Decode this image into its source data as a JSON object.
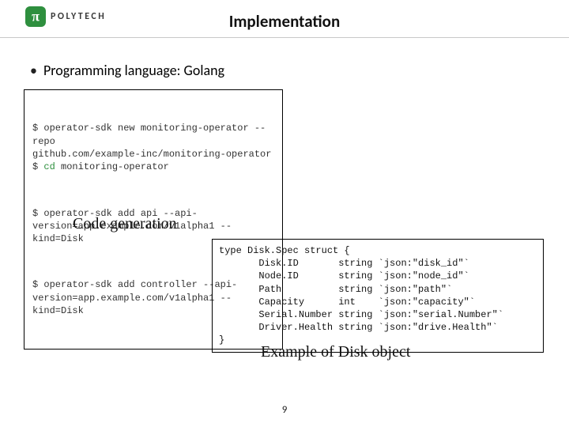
{
  "logo": {
    "symbol": "π",
    "text": "POLYTECH"
  },
  "title": "Implementation",
  "bullet": "Programming language: Golang",
  "code1": {
    "block1_line1": "$ operator-sdk new monitoring-operator --repo",
    "block1_line2": "github.com/example-inc/monitoring-operator",
    "block1_line3a": "$ ",
    "block1_line3_cd": "cd",
    "block1_line3b": " monitoring-operator",
    "block2_line1": "$ operator-sdk add api --api-",
    "block2_line2": "version=app.example.com/v1alpha1 --kind=Disk",
    "block3_line1": "$ operator-sdk add controller --api-",
    "block3_line2": "version=app.example.com/v1alpha1 --kind=Disk"
  },
  "caption1": "Code generation",
  "code2": {
    "l1": "type Disk.Spec struct {",
    "l2": "       Disk.ID       string `json:\"disk_id\"`",
    "l3": "       Node.ID       string `json:\"node_id\"`",
    "l4": "       Path          string `json:\"path\"`",
    "l5": "       Capacity      int    `json:\"capacity\"`",
    "l6": "       Serial.Number string `json:\"serial.Number\"`",
    "l7": "       Driver.Health string `json:\"drive.Health\"`",
    "l8": "}"
  },
  "caption2": "Example of Disk object",
  "page_number": "9"
}
